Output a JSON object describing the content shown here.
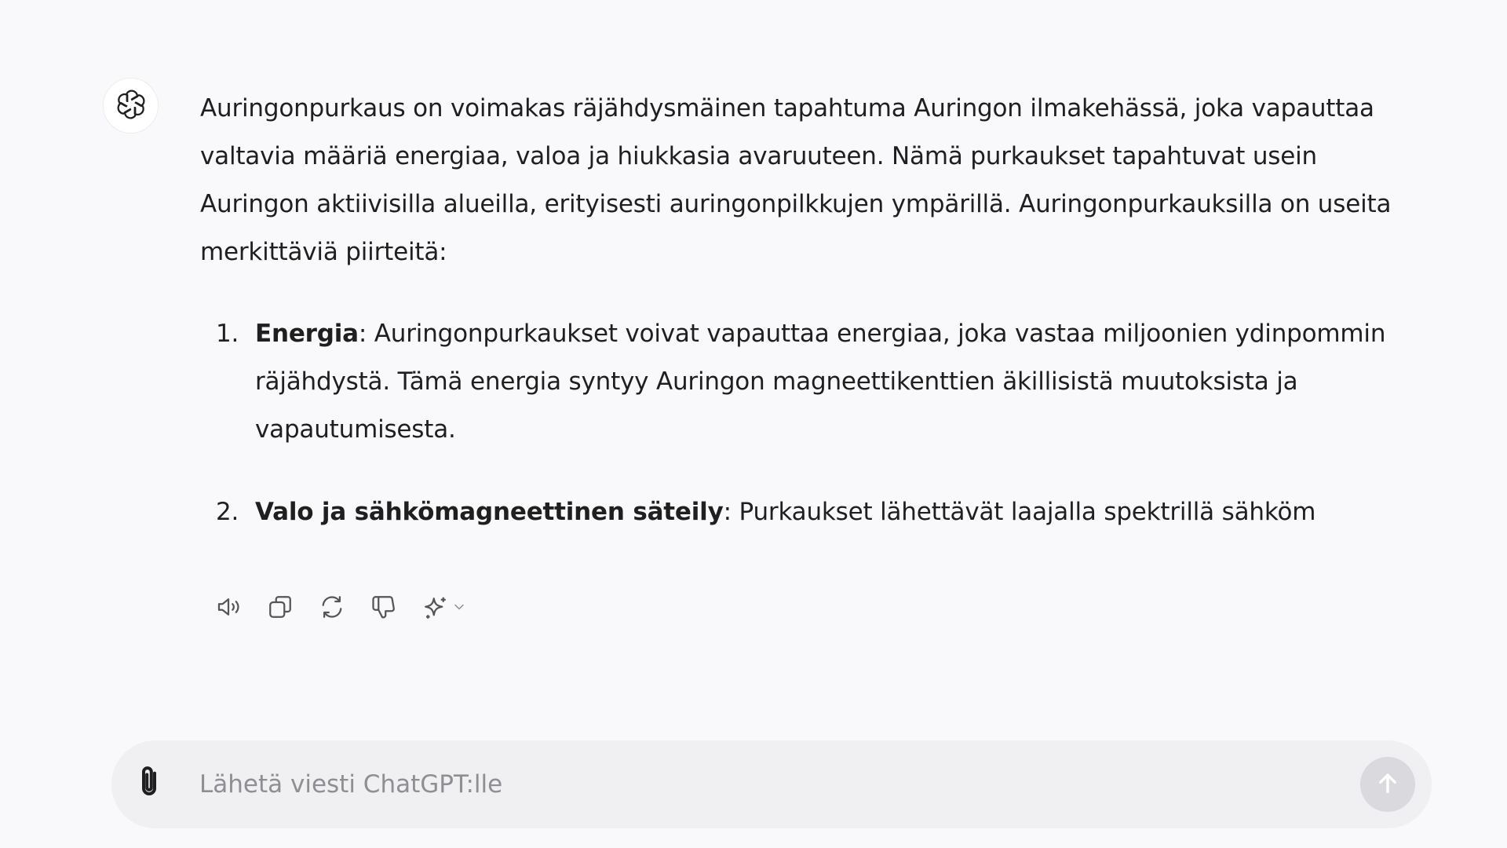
{
  "assistant": {
    "avatar_icon": "openai-logo-icon",
    "intro": "Auringonpurkaus on voimakas räjähdysmäinen tapahtuma Auringon ilmakehässä, joka vapauttaa valtavia määriä energiaa, valoa ja hiukkasia avaruuteen. Nämä purkaukset tapahtuvat usein Auringon aktiivisilla alueilla, erityisesti auringonpilkkujen ympärillä. Auringonpurkauksilla on useita merkittäviä piirteitä:",
    "items": [
      {
        "number": "1.",
        "term": "Energia",
        "text": ": Auringonpurkaukset voivat vapauttaa energiaa, joka vastaa miljoonien ydinpommin räjähdystä. Tämä energia syntyy Auringon magneettikenttien äkillisistä muutoksista ja vapautumisesta."
      },
      {
        "number": "2.",
        "term": "Valo ja sähkömagneettinen säteily",
        "text": ": Purkaukset lähettävät laajalla spektrillä sähköm"
      }
    ]
  },
  "actions": {
    "icons": [
      "speaker-icon",
      "copy-icon",
      "regenerate-icon",
      "thumbs-down-icon",
      "sparkle-icon",
      "chevron-down-icon"
    ]
  },
  "composer": {
    "placeholder": "Lähetä viesti ChatGPT:lle",
    "value": "",
    "attach_icon": "paperclip-icon",
    "send_icon": "arrow-up-icon"
  },
  "colors": {
    "background": "#f9f9fc",
    "composer_background": "#f0f0f3",
    "send_disabled": "#d9d9de",
    "text": "#1f1f1f",
    "placeholder": "#8e8e93"
  }
}
